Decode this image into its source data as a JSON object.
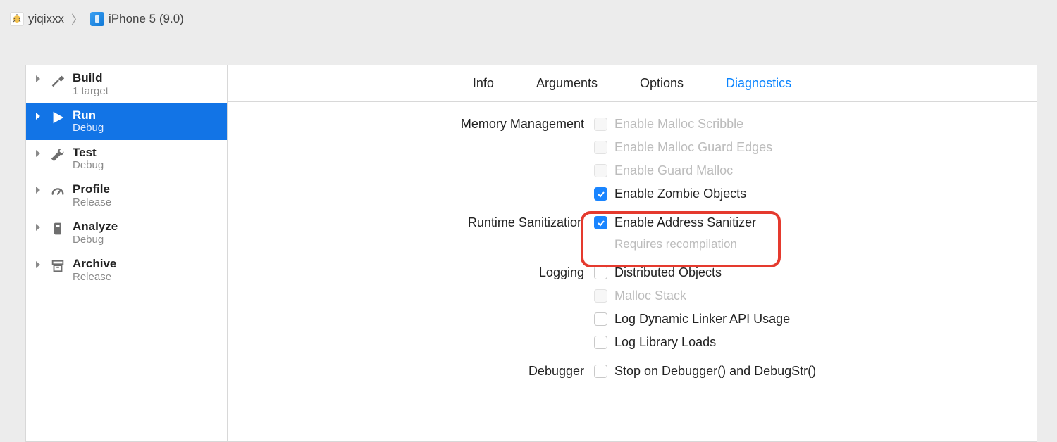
{
  "breadcrumb": {
    "project": "yiqixxx",
    "device": "iPhone 5 (9.0)"
  },
  "sidebar": {
    "items": [
      {
        "title": "Build",
        "sub": "1 target"
      },
      {
        "title": "Run",
        "sub": "Debug"
      },
      {
        "title": "Test",
        "sub": "Debug"
      },
      {
        "title": "Profile",
        "sub": "Release"
      },
      {
        "title": "Analyze",
        "sub": "Debug"
      },
      {
        "title": "Archive",
        "sub": "Release"
      }
    ]
  },
  "tabs": {
    "info": "Info",
    "arguments": "Arguments",
    "options": "Options",
    "diagnostics": "Diagnostics"
  },
  "sections": {
    "memory": {
      "label": "Memory Management",
      "scribble": "Enable Malloc Scribble",
      "guard_edges": "Enable Malloc Guard Edges",
      "guard_malloc": "Enable Guard Malloc",
      "zombie": "Enable Zombie Objects"
    },
    "runtime": {
      "label": "Runtime Sanitization",
      "asan": "Enable Address Sanitizer",
      "asan_note": "Requires recompilation"
    },
    "logging": {
      "label": "Logging",
      "dist": "Distributed Objects",
      "malloc_stack": "Malloc Stack",
      "dyld": "Log Dynamic Linker API Usage",
      "lib_loads": "Log Library Loads"
    },
    "debugger": {
      "label": "Debugger",
      "stop": "Stop on Debugger() and DebugStr()"
    }
  }
}
